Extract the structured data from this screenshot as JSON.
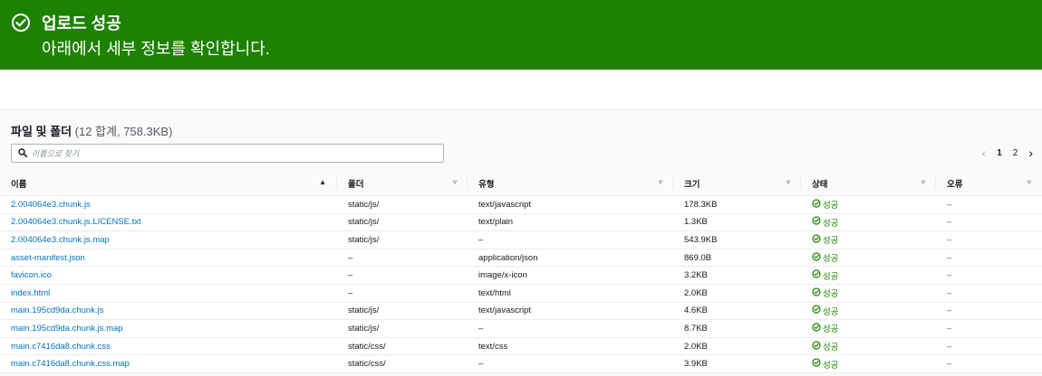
{
  "banner": {
    "title": "업로드 성공",
    "message": "아래에서 세부 정보를 확인합니다.",
    "color": "#1d8102"
  },
  "files": {
    "heading": "파일 및 폴더",
    "count": "(12 합계, 758.3KB)",
    "search_placeholder": "이름으로 찾기",
    "pagination": {
      "pages": [
        "1",
        "2"
      ],
      "current": "1"
    },
    "columns": [
      "이름",
      "폴더",
      "유형",
      "크기",
      "상태",
      "오류"
    ],
    "rows": [
      {
        "name": "2.004064e3.chunk.js",
        "folder": "static/js/",
        "type": "text/javascript",
        "size": "178.3KB",
        "status": "성공",
        "error": "–"
      },
      {
        "name": "2.004064e3.chunk.js.LICENSE.txt",
        "folder": "static/js/",
        "type": "text/plain",
        "size": "1.3KB",
        "status": "성공",
        "error": "–"
      },
      {
        "name": "2.004064e3.chunk.js.map",
        "folder": "static/js/",
        "type": "–",
        "size": "543.9KB",
        "status": "성공",
        "error": "–"
      },
      {
        "name": "asset-manifest.json",
        "folder": "–",
        "type": "application/json",
        "size": "869.0B",
        "status": "성공",
        "error": "–"
      },
      {
        "name": "favicon.ico",
        "folder": "–",
        "type": "image/x-icon",
        "size": "3.2KB",
        "status": "성공",
        "error": "–"
      },
      {
        "name": "index.html",
        "folder": "–",
        "type": "text/html",
        "size": "2.0KB",
        "status": "성공",
        "error": "–"
      },
      {
        "name": "main.195cd9da.chunk.js",
        "folder": "static/js/",
        "type": "text/javascript",
        "size": "4.6KB",
        "status": "성공",
        "error": "–"
      },
      {
        "name": "main.195cd9da.chunk.js.map",
        "folder": "static/js/",
        "type": "–",
        "size": "8.7KB",
        "status": "성공",
        "error": "–"
      },
      {
        "name": "main.c7416da8.chunk.css",
        "folder": "static/css/",
        "type": "text/css",
        "size": "2.0KB",
        "status": "성공",
        "error": "–"
      },
      {
        "name": "main.c7416da8.chunk.css.map",
        "folder": "static/css/",
        "type": "–",
        "size": "3.9KB",
        "status": "성공",
        "error": "–"
      }
    ]
  }
}
